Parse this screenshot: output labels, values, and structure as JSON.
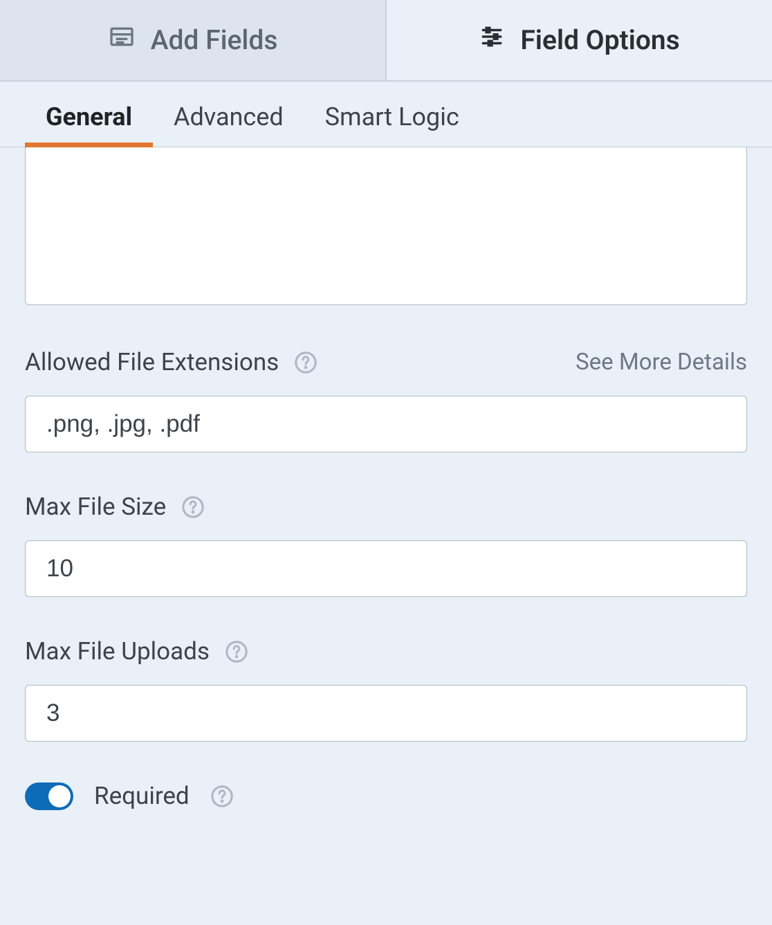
{
  "topTabs": {
    "addFields": "Add Fields",
    "fieldOptions": "Field Options"
  },
  "subTabs": {
    "general": "General",
    "advanced": "Advanced",
    "smartLogic": "Smart Logic"
  },
  "description": {
    "value": ""
  },
  "extensions": {
    "label": "Allowed File Extensions",
    "seeMore": "See More Details",
    "value": ".png, .jpg, .pdf"
  },
  "maxSize": {
    "label": "Max File Size",
    "value": "10"
  },
  "maxUploads": {
    "label": "Max File Uploads",
    "value": "3"
  },
  "required": {
    "label": "Required",
    "enabled": true
  }
}
